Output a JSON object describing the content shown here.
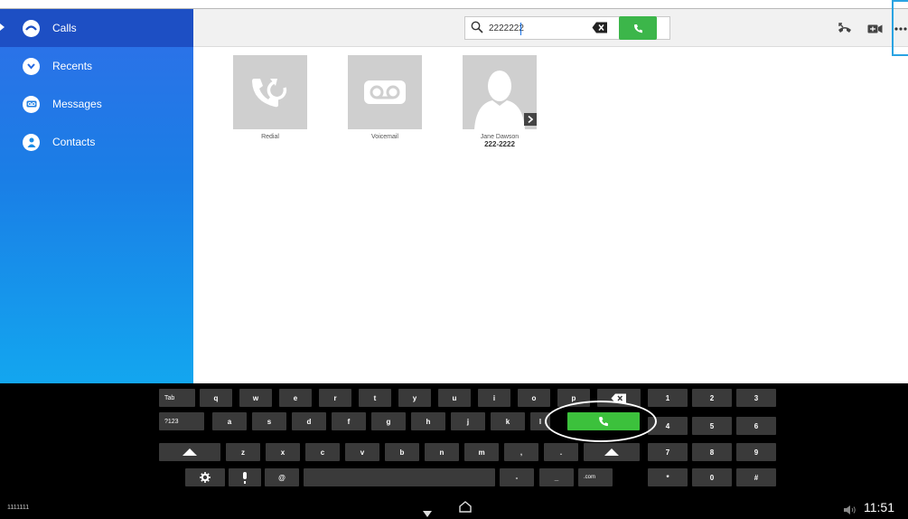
{
  "sidebar": {
    "items": [
      {
        "label": "Calls",
        "icon": "calls-icon",
        "active": true
      },
      {
        "label": "Recents",
        "icon": "recents-icon",
        "active": false
      },
      {
        "label": "Messages",
        "icon": "voicemail-icon",
        "active": false
      },
      {
        "label": "Contacts",
        "icon": "contacts-icon",
        "active": false
      }
    ]
  },
  "search": {
    "value": "2222222",
    "icon": "search-icon"
  },
  "tiles": [
    {
      "label": "Redial",
      "icon": "redial-icon"
    },
    {
      "label": "Voicemail",
      "icon": "voicemail-icon"
    },
    {
      "label": "Jane Dawson",
      "sub": "222-2222",
      "icon": "person-icon"
    }
  ],
  "keyboard": {
    "row1": [
      "Tab",
      "q",
      "w",
      "e",
      "r",
      "t",
      "y",
      "u",
      "i",
      "o",
      "p"
    ],
    "row2": [
      "?123",
      "a",
      "s",
      "d",
      "f",
      "g",
      "h",
      "j",
      "k",
      "l"
    ],
    "row3": [
      "z",
      "x",
      "c",
      "v",
      "b",
      "n",
      "m",
      ",",
      "."
    ],
    "row4": [
      "@",
      "-",
      "_",
      ".com"
    ],
    "numpad": [
      "1",
      "2",
      "3",
      "4",
      "5",
      "6",
      "7",
      "8",
      "9",
      "*",
      "0",
      "#"
    ]
  },
  "navbar": {
    "left_text": "1111111",
    "clock": "11:51"
  },
  "colors": {
    "sidebar_top": "#2f6fe8",
    "sidebar_bottom": "#13a6ef",
    "call_green": "#3cb64a",
    "highlight": "#2aa3e2"
  }
}
